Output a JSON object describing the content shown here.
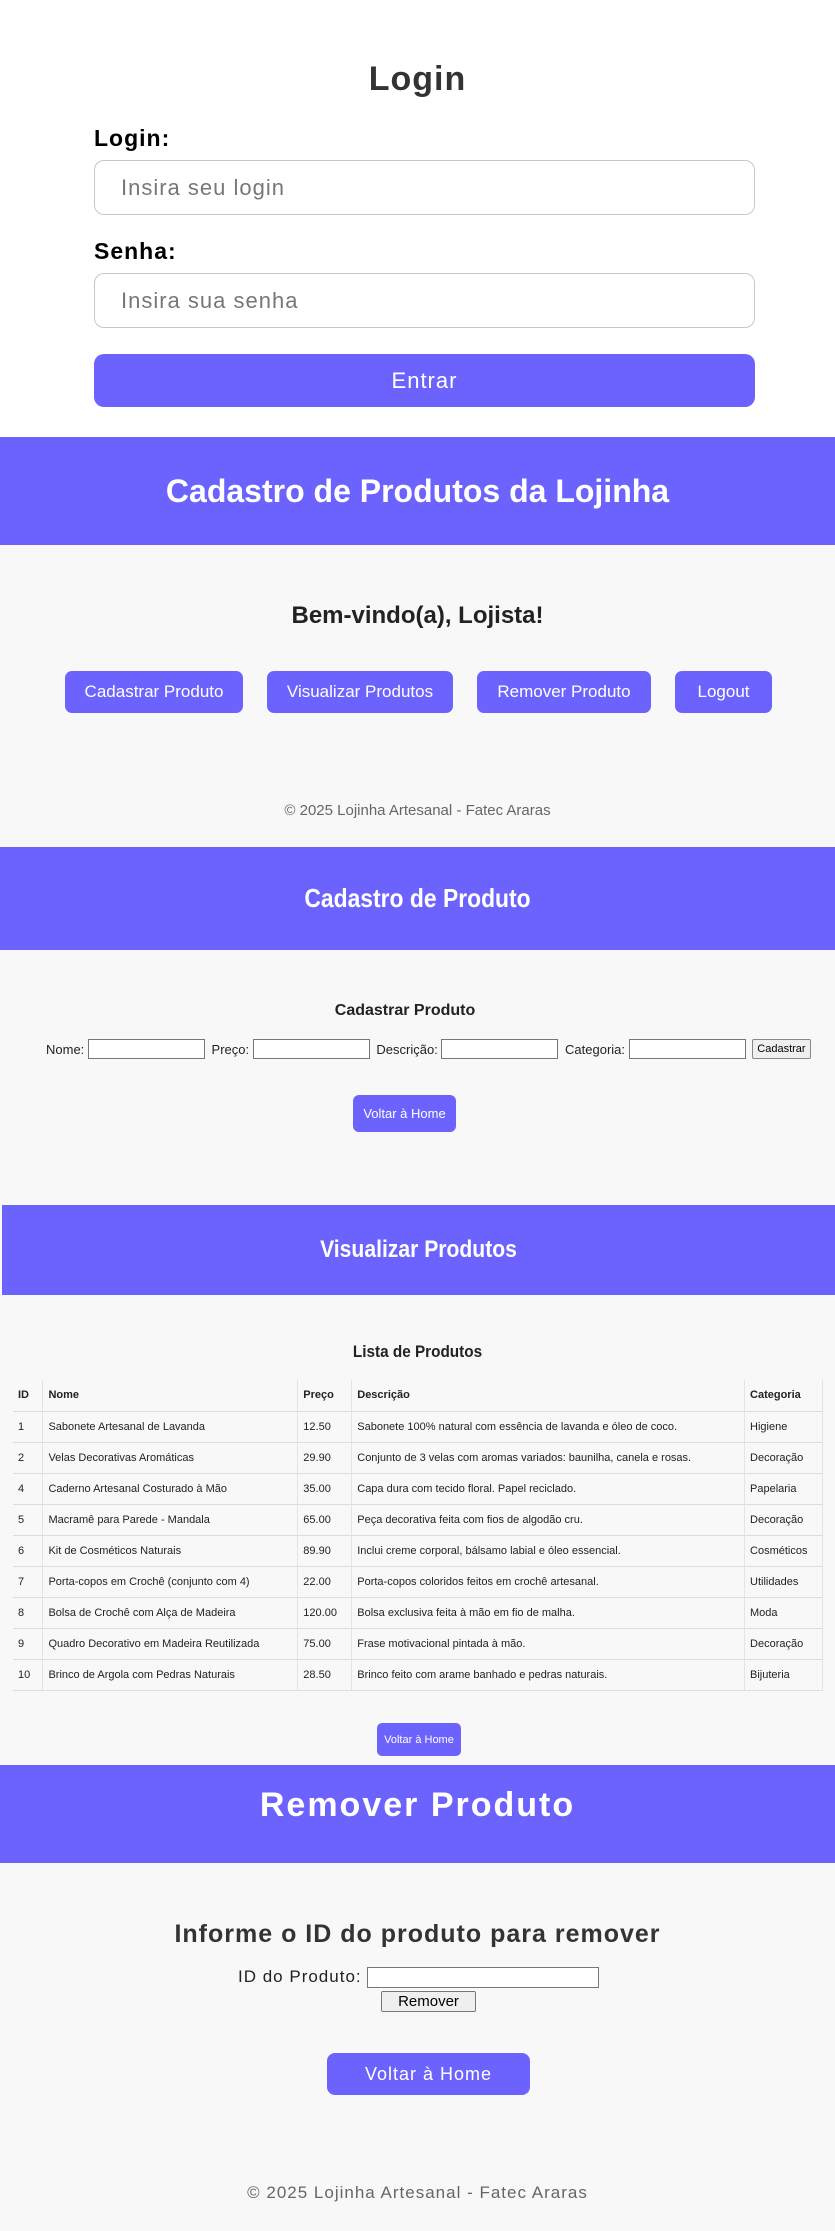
{
  "login": {
    "title": "Login",
    "login_label": "Login:",
    "login_placeholder": "Insira seu login",
    "password_label": "Senha:",
    "password_placeholder": "Insira sua senha",
    "submit_label": "Entrar"
  },
  "home": {
    "header_title": "Cadastro de Produtos da Lojinha",
    "welcome": "Bem-vindo(a), Lojista!",
    "buttons": [
      "Cadastrar Produto",
      "Visualizar Produtos",
      "Remover Produto",
      "Logout"
    ],
    "footer": "© 2025 Lojinha Artesanal - Fatec Araras"
  },
  "cadastro": {
    "header_title": "Cadastro de Produto",
    "form_title": "Cadastrar Produto",
    "labels": [
      "Nome:",
      "Preço:",
      "Descrição:",
      "Categoria:"
    ],
    "submit_label": "Cadastrar",
    "home_button": "Voltar à Home"
  },
  "visualizar": {
    "header_title": "Visualizar Produtos",
    "list_title": "Lista de Produtos",
    "columns": [
      "ID",
      "Nome",
      "Preço",
      "Descrição",
      "Categoria"
    ],
    "rows": [
      [
        "1",
        "Sabonete Artesanal de Lavanda",
        "12.50",
        "Sabonete 100% natural com essência de lavanda e óleo de coco.",
        "Higiene"
      ],
      [
        "2",
        "Velas Decorativas Aromáticas",
        "29.90",
        "Conjunto de 3 velas com aromas variados: baunilha, canela e rosas.",
        "Decoração"
      ],
      [
        "4",
        "Caderno Artesanal Costurado à Mão",
        "35.00",
        "Capa dura com tecido floral. Papel reciclado.",
        "Papelaria"
      ],
      [
        "5",
        "Macramê para Parede - Mandala",
        "65.00",
        "Peça decorativa feita com fios de algodão cru.",
        "Decoração"
      ],
      [
        "6",
        "Kit de Cosméticos Naturais",
        "89.90",
        "Inclui creme corporal, bálsamo labial e óleo essencial.",
        "Cosméticos"
      ],
      [
        "7",
        "Porta-copos em Crochê (conjunto com 4)",
        "22.00",
        "Porta-copos coloridos feitos em crochê artesanal.",
        "Utilidades"
      ],
      [
        "8",
        "Bolsa de Crochê com Alça de Madeira",
        "120.00",
        "Bolsa exclusiva feita à mão em fio de malha.",
        "Moda"
      ],
      [
        "9",
        "Quadro Decorativo em Madeira Reutilizada",
        "75.00",
        "Frase motivacional pintada à mão.",
        "Decoração"
      ],
      [
        "10",
        "Brinco de Argola com Pedras Naturais",
        "28.50",
        "Brinco feito com arame banhado e pedras naturais.",
        "Bijuteria"
      ]
    ],
    "home_button": "Voltar à Home"
  },
  "remover": {
    "header_title": "Remover Produto",
    "prompt": "Informe o ID do produto para remover",
    "id_label": "ID do Produto:",
    "submit_label": "Remover",
    "home_button": "Voltar à Home",
    "footer": "© 2025 Lojinha Artesanal - Fatec Araras"
  }
}
